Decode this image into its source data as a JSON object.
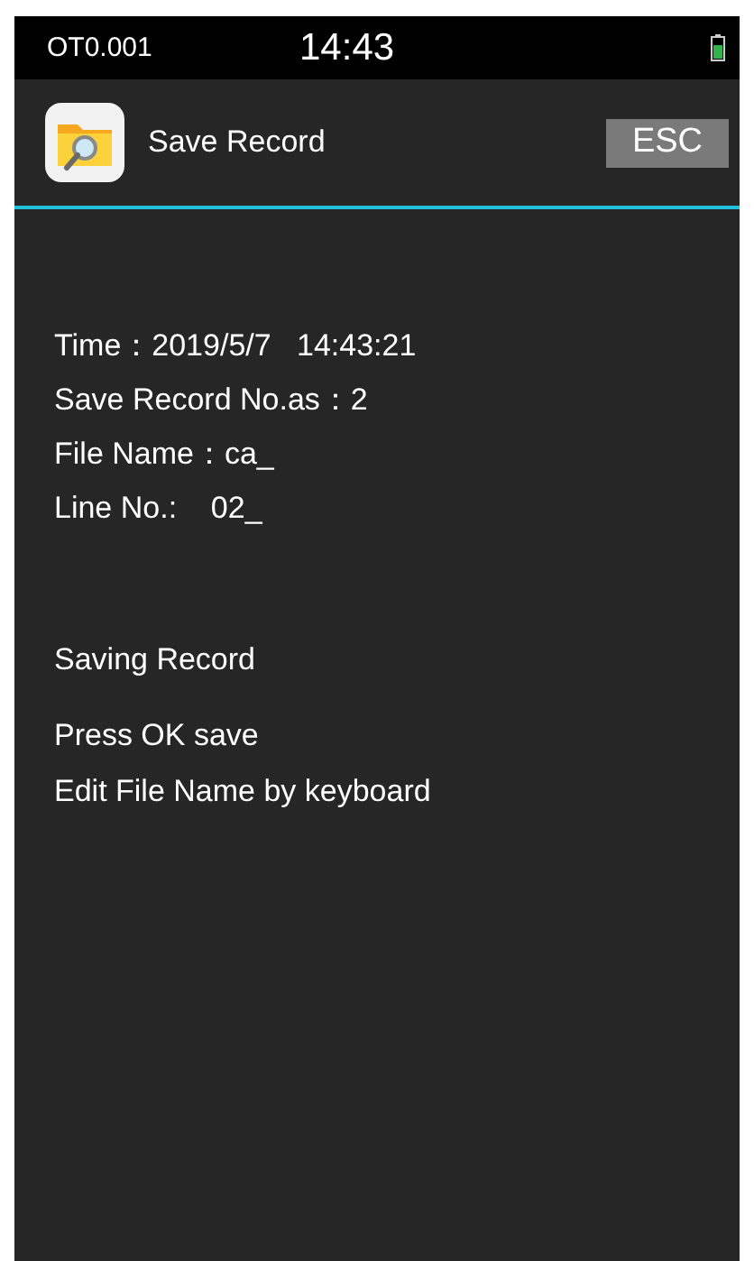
{
  "status_bar": {
    "left": "OT0.001",
    "time": "14:43"
  },
  "header": {
    "title": "Save Record",
    "esc_button": "ESC"
  },
  "details": [
    "Time：2019/5/7   14:43:21",
    "Save Record No.as：2",
    "File Name：ca_",
    "Line No.:    02_"
  ],
  "status": "Saving Record",
  "instructions": [
    "Press OK save",
    "Edit File Name by keyboard"
  ]
}
